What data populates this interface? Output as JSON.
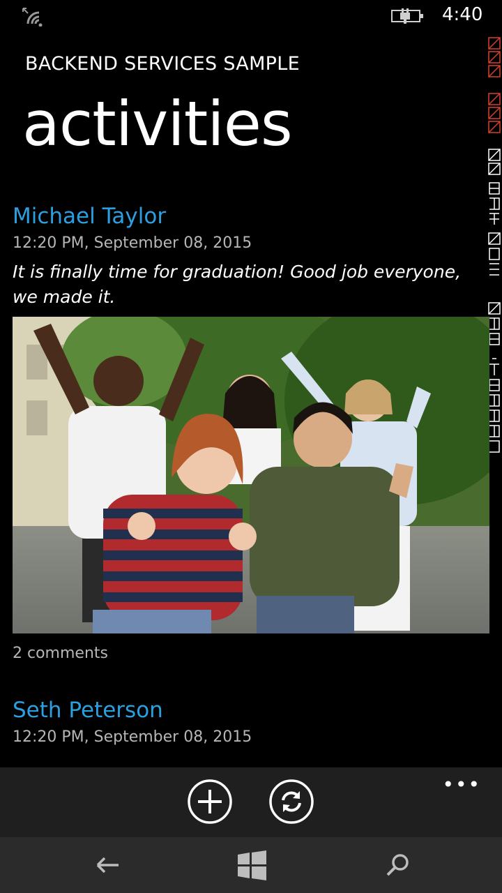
{
  "status": {
    "time": "4:40",
    "icons": [
      "wifi-signal-icon",
      "battery-charging-icon"
    ]
  },
  "header": {
    "app_title": "BACKEND SERVICES SAMPLE",
    "page_title": "activities"
  },
  "activities": [
    {
      "author": "Michael Taylor",
      "date": "12:20 PM, September 08, 2015",
      "text": "It is finally time for graduation! Good job everyone, we made it.",
      "has_photo": true,
      "comments": "2 comments"
    },
    {
      "author": "Seth Peterson",
      "date": "12:20 PM, September 08, 2015"
    }
  ],
  "appbar": {
    "buttons": [
      "add-icon",
      "refresh-icon"
    ],
    "more_label": "•••"
  },
  "navbar": {
    "buttons": [
      "back-icon",
      "windows-start-icon",
      "search-icon"
    ]
  },
  "colors": {
    "accent": "#2b9fe0",
    "background": "#000000",
    "appbar": "#1f1f1f",
    "navbar": "#2b2b2b"
  }
}
